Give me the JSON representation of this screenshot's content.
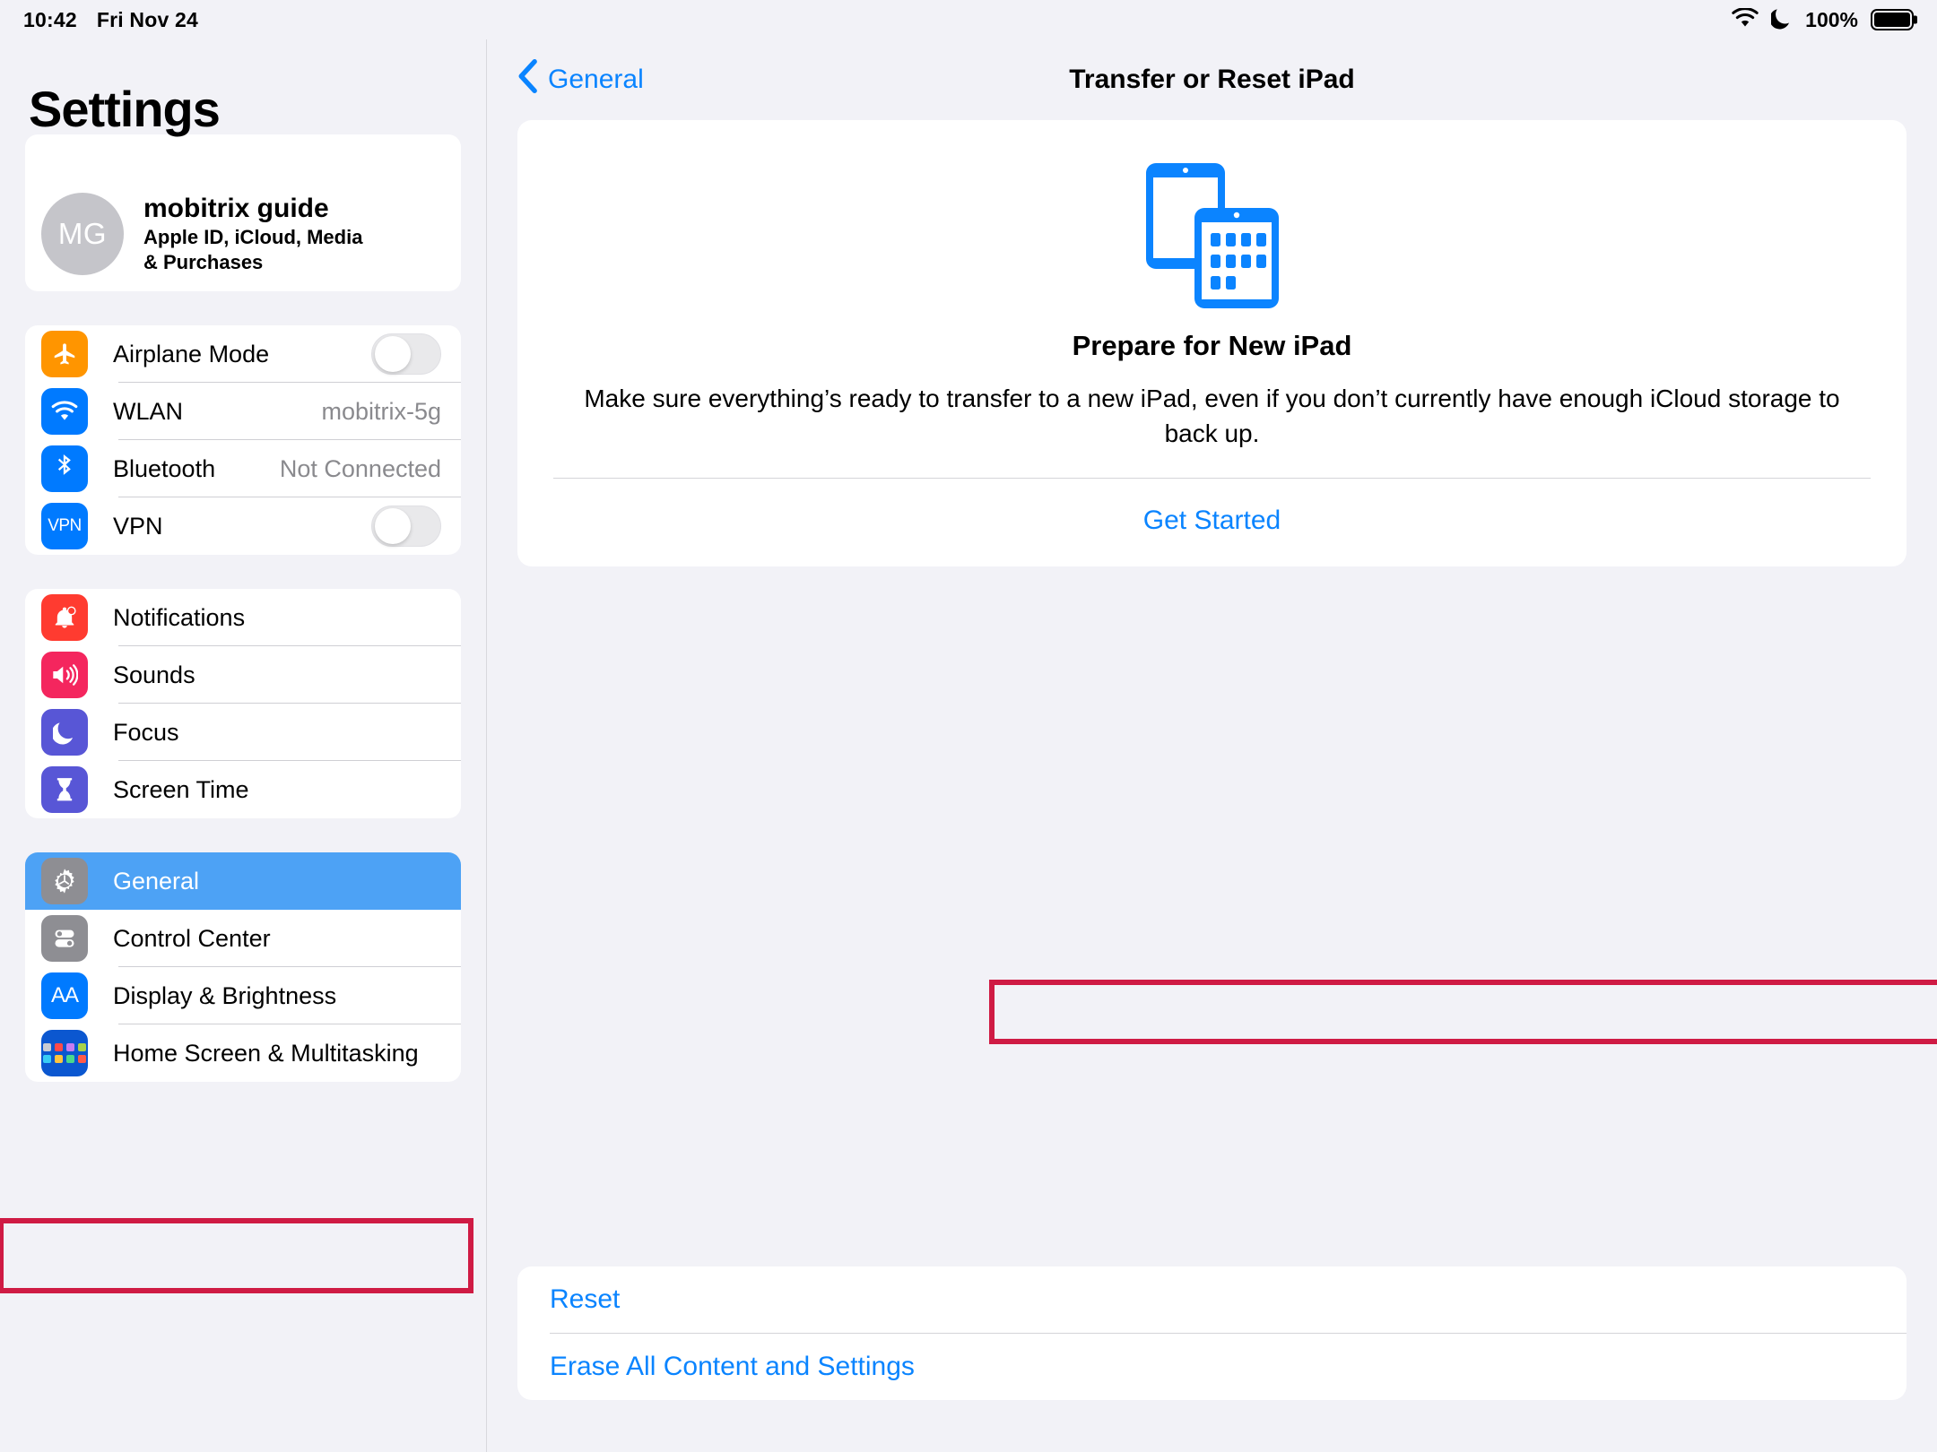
{
  "status_bar": {
    "time": "10:42",
    "date": "Fri Nov 24",
    "battery_percent": "100%",
    "icons": [
      "wifi-icon",
      "moon-icon",
      "battery-icon"
    ]
  },
  "sidebar": {
    "title": "Settings",
    "profile": {
      "initials": "MG",
      "name": "mobitrix guide",
      "subtitle_line1": "Apple ID, iCloud, Media",
      "subtitle_line2": "& Purchases"
    },
    "groups": [
      {
        "items": [
          {
            "label": "Airplane Mode",
            "icon": "airplane-icon",
            "icon_color": "#ff9500",
            "control": "toggle",
            "value": ""
          },
          {
            "label": "WLAN",
            "icon": "wifi-icon",
            "icon_color": "#007aff",
            "control": "value",
            "value": "mobitrix-5g"
          },
          {
            "label": "Bluetooth",
            "icon": "bluetooth-icon",
            "icon_color": "#007aff",
            "control": "value",
            "value": "Not Connected"
          },
          {
            "label": "VPN",
            "icon": "vpn-icon",
            "icon_color": "#007aff",
            "control": "toggle",
            "value": ""
          }
        ]
      },
      {
        "items": [
          {
            "label": "Notifications",
            "icon": "bell-icon",
            "icon_color": "#ff3b30",
            "control": "none",
            "value": ""
          },
          {
            "label": "Sounds",
            "icon": "speaker-icon",
            "icon_color": "#f4265e",
            "control": "none",
            "value": ""
          },
          {
            "label": "Focus",
            "icon": "moon-icon",
            "icon_color": "#5856d6",
            "control": "none",
            "value": ""
          },
          {
            "label": "Screen Time",
            "icon": "hourglass-icon",
            "icon_color": "#5856d6",
            "control": "none",
            "value": ""
          }
        ]
      },
      {
        "items": [
          {
            "label": "General",
            "icon": "gear-icon",
            "icon_color": "#8e8e93",
            "control": "none",
            "value": "",
            "selected": true
          },
          {
            "label": "Control Center",
            "icon": "sliders-icon",
            "icon_color": "#8e8e93",
            "control": "none",
            "value": ""
          },
          {
            "label": "Display & Brightness",
            "icon": "text-size-icon",
            "icon_color": "#007aff",
            "control": "none",
            "value": ""
          },
          {
            "label": "Home Screen & Multitasking",
            "icon": "app-grid-icon",
            "icon_color": "#0b57d0",
            "control": "none",
            "value": ""
          }
        ]
      }
    ]
  },
  "detail": {
    "back_label": "General",
    "title": "Transfer or Reset iPad",
    "prepare_card": {
      "illustration": "two-ipads-icon",
      "heading": "Prepare for New iPad",
      "description": "Make sure everything’s ready to transfer to a new iPad, even if you don’t currently have enough iCloud storage to back up.",
      "action_label": "Get Started"
    },
    "actions": [
      {
        "label": "Reset"
      },
      {
        "label": "Erase All Content and Settings"
      }
    ]
  },
  "annotations": {
    "color": "#cf1b44",
    "boxes": [
      {
        "name": "general-highlight",
        "target": "General"
      },
      {
        "name": "erase-highlight",
        "target": "Erase All Content and Settings"
      }
    ]
  },
  "colors": {
    "accent_blue": "#0a84ff",
    "selected_row": "#4da2f5",
    "page_background": "#f2f2f7",
    "card_background": "#ffffff",
    "annotation": "#cf1b44"
  }
}
